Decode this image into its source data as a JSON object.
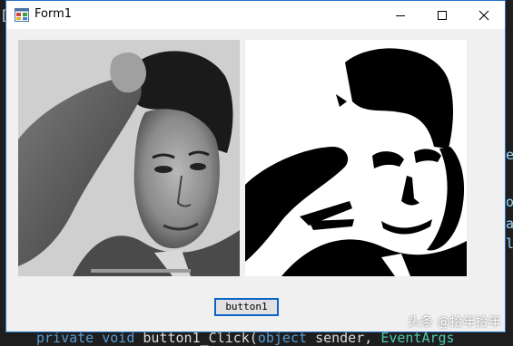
{
  "window": {
    "title": "Form1",
    "border_color": "#2a75c7",
    "icons": {
      "app": "form-app-icon",
      "minimize": "minimize-icon",
      "maximize": "maximize-icon",
      "close": "close-icon"
    }
  },
  "pictures": {
    "left": {
      "description_icon": "grayscale-portrait-image",
      "tone": "grayscale"
    },
    "right": {
      "description_icon": "binarized-portrait-image",
      "tone": "black-and-white"
    }
  },
  "button1": {
    "label": "button1"
  },
  "watermark": {
    "text": "头条 @拾年拾年"
  },
  "ide_background": {
    "code_line": {
      "kw1": "private",
      "kw2": "void",
      "method": "button1_Click(",
      "kw3": "object",
      "param": "sender,",
      "type": "EventArgs"
    }
  }
}
